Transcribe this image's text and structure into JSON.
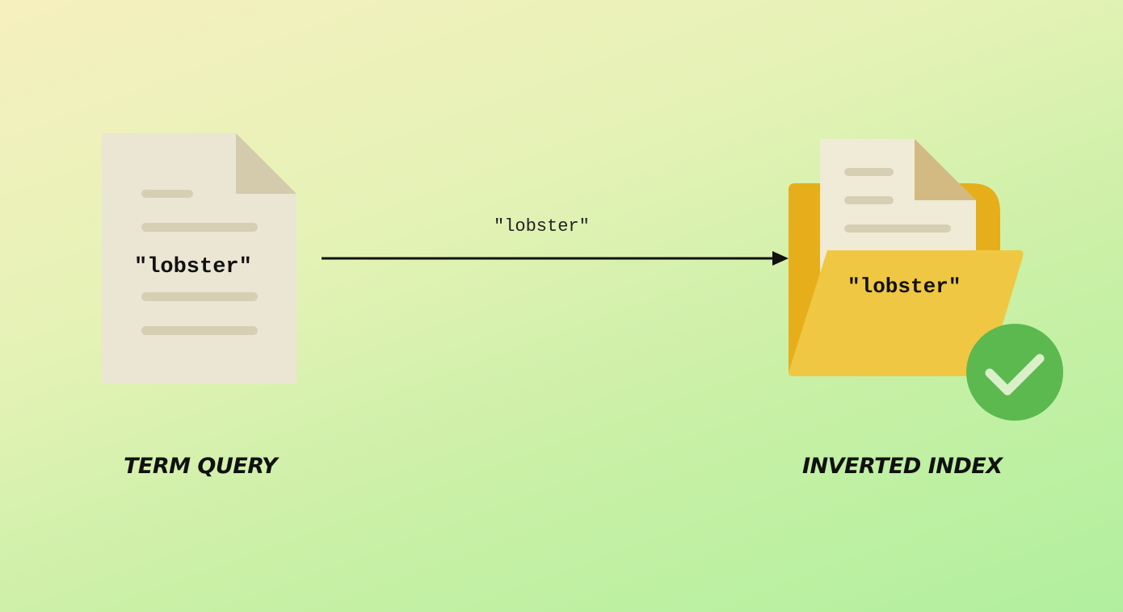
{
  "left": {
    "document_text": "\"lobster\"",
    "caption": "TERM QUERY"
  },
  "arrow": {
    "label": "\"lobster\""
  },
  "right": {
    "folder_text": "\"lobster\"",
    "caption": "INVERTED INDEX",
    "status_icon": "check-circle-icon"
  },
  "colors": {
    "document_paper": "#ebe6d3",
    "document_fold": "#d3cbab",
    "document_lines": "#d6cfb4",
    "folder_back": "#e6ae1a",
    "folder_front": "#f0c742",
    "check_green": "#5cb950"
  }
}
